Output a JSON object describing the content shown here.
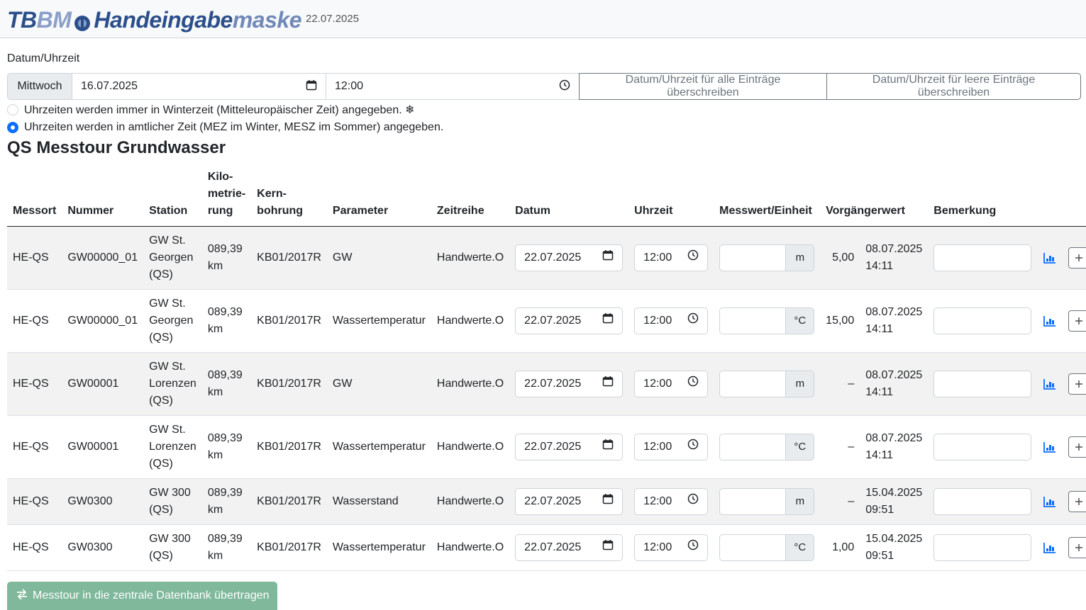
{
  "header": {
    "logo_parts": [
      "TB",
      "BM",
      "Handeingabe",
      "maske"
    ],
    "date": "22.07.2025"
  },
  "datetime": {
    "label": "Datum/Uhrzeit",
    "weekday": "Mittwoch",
    "date": "16.07.2025",
    "time": "12:00",
    "btn_all": "Datum/Uhrzeit für alle Einträge überschreiben",
    "btn_empty": "Datum/Uhrzeit für leere Einträge überschreiben"
  },
  "timezone_options": [
    {
      "label": "Uhrzeiten werden immer in Winterzeit (Mitteleuropäischer Zeit) angegeben. ❄",
      "selected": false
    },
    {
      "label": "Uhrzeiten werden in amtlicher Zeit (MEZ im Winter, MESZ im Sommer) angegeben.",
      "selected": true
    }
  ],
  "section_title": "QS Messtour Grundwasser",
  "table": {
    "columns": {
      "messort": "Messort",
      "nummer": "Nummer",
      "station": "Station",
      "kilometrierung_1": "Kilo-",
      "kilometrierung_2": "metrie-",
      "kilometrierung_3": "rung",
      "kernbohrung_1": "Kern-",
      "kernbohrung_2": "bohrung",
      "parameter": "Parameter",
      "zeitreihe": "Zeitreihe",
      "datum": "Datum",
      "uhrzeit": "Uhrzeit",
      "messwert": "Messwert/Einheit",
      "vorgaenger": "Vorgängerwert",
      "bemerkung": "Bemerkung"
    },
    "rows": [
      {
        "messort": "HE-QS",
        "nummer": "GW00000_01",
        "station_1": "GW St.",
        "station_2": "Georgen",
        "station_3": "(QS)",
        "km_1": "089,39",
        "km_2": "km",
        "kern": "KB01/2017R",
        "parameter": "GW",
        "zeitreihe": "Handwerte.O",
        "datum": "22.07.2025",
        "uhrzeit": "12:00",
        "einheit": "m",
        "vorgaenger_wert": "5,00",
        "vorgaenger_datum": "08.07.2025",
        "vorgaenger_zeit": "14:11"
      },
      {
        "messort": "HE-QS",
        "nummer": "GW00000_01",
        "station_1": "GW St.",
        "station_2": "Georgen",
        "station_3": "(QS)",
        "km_1": "089,39",
        "km_2": "km",
        "kern": "KB01/2017R",
        "parameter": "Wassertemperatur",
        "zeitreihe": "Handwerte.O",
        "datum": "22.07.2025",
        "uhrzeit": "12:00",
        "einheit": "°C",
        "vorgaenger_wert": "15,00",
        "vorgaenger_datum": "08.07.2025",
        "vorgaenger_zeit": "14:11"
      },
      {
        "messort": "HE-QS",
        "nummer": "GW00001",
        "station_1": "GW St.",
        "station_2": "Lorenzen",
        "station_3": "(QS)",
        "km_1": "089,39",
        "km_2": "km",
        "kern": "KB01/2017R",
        "parameter": "GW",
        "zeitreihe": "Handwerte.O",
        "datum": "22.07.2025",
        "uhrzeit": "12:00",
        "einheit": "m",
        "vorgaenger_wert": "–",
        "vorgaenger_datum": "08.07.2025",
        "vorgaenger_zeit": "14:11"
      },
      {
        "messort": "HE-QS",
        "nummer": "GW00001",
        "station_1": "GW St.",
        "station_2": "Lorenzen",
        "station_3": "(QS)",
        "km_1": "089,39",
        "km_2": "km",
        "kern": "KB01/2017R",
        "parameter": "Wassertemperatur",
        "zeitreihe": "Handwerte.O",
        "datum": "22.07.2025",
        "uhrzeit": "12:00",
        "einheit": "°C",
        "vorgaenger_wert": "–",
        "vorgaenger_datum": "08.07.2025",
        "vorgaenger_zeit": "14:11"
      },
      {
        "messort": "HE-QS",
        "nummer": "GW0300",
        "station_1": "GW 300",
        "station_2": "(QS)",
        "station_3": "",
        "km_1": "089,39",
        "km_2": "km",
        "kern": "KB01/2017R",
        "parameter": "Wasserstand",
        "zeitreihe": "Handwerte.O",
        "datum": "22.07.2025",
        "uhrzeit": "12:00",
        "einheit": "m",
        "vorgaenger_wert": "–",
        "vorgaenger_datum": "15.04.2025",
        "vorgaenger_zeit": "09:51"
      },
      {
        "messort": "HE-QS",
        "nummer": "GW0300",
        "station_1": "GW 300",
        "station_2": "(QS)",
        "station_3": "",
        "km_1": "089,39",
        "km_2": "km",
        "kern": "KB01/2017R",
        "parameter": "Wassertemperatur",
        "zeitreihe": "Handwerte.O",
        "datum": "22.07.2025",
        "uhrzeit": "12:00",
        "einheit": "°C",
        "vorgaenger_wert": "1,00",
        "vorgaenger_datum": "15.04.2025",
        "vorgaenger_zeit": "09:51"
      }
    ]
  },
  "submit_label": "Messtour in die zentrale Datenbank übertragen",
  "colors": {
    "primary": "#0d6efd",
    "success_disabled": "#7fb89a",
    "logo_dark": "#2b4f8a",
    "logo_light": "#8a9fc7",
    "chart_icon": "#0d6efd"
  }
}
